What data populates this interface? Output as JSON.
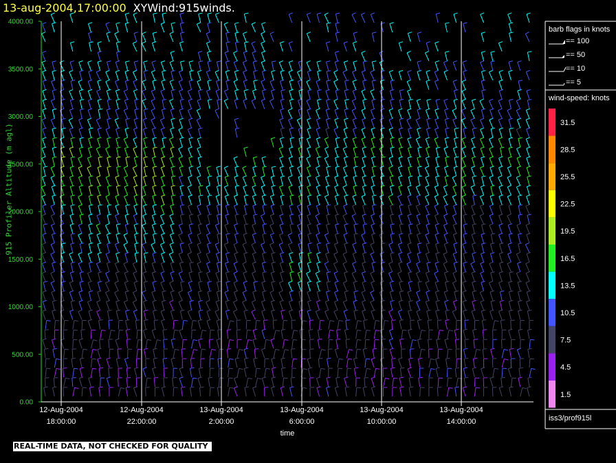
{
  "header": {
    "timestamp": "13-aug-2004,17:00:00",
    "product": "XYWind:915winds."
  },
  "notice": "REAL-TIME DATA, NOT CHECKED FOR QUALITY",
  "station": "iss3/prof915l",
  "chart_data": {
    "type": "wind-barb time-height",
    "title": "XYWind:915winds.",
    "xlabel": "time",
    "ylabel": "915 Profiler Altitude (m agl)",
    "ylim": [
      0,
      4000
    ],
    "yticks": [
      "0.00",
      "500.00",
      "1000.00",
      "1500.00",
      "2000.00",
      "2500.00",
      "3000.00",
      "3500.00",
      "4000.00"
    ],
    "xticks": [
      {
        "date": "12-Aug-2004",
        "time": "18:00:00"
      },
      {
        "date": "12-Aug-2004",
        "time": "22:00:00"
      },
      {
        "date": "13-Aug-2004",
        "time": "2:00:00"
      },
      {
        "date": "13-Aug-2004",
        "time": "6:00:00"
      },
      {
        "date": "13-Aug-2004",
        "time": "10:00:00"
      },
      {
        "date": "13-Aug-2004",
        "time": "14:00:00"
      }
    ],
    "barb_legend": {
      "title": "barb flags in knots",
      "entries": [
        "== 100",
        "== 50",
        "== 10",
        "== 5"
      ]
    },
    "speed_legend": {
      "title": "wind-speed: knots",
      "levels": [
        {
          "label": "31.5",
          "color": "#ff2244"
        },
        {
          "label": "28.5",
          "color": "#ff8800"
        },
        {
          "label": "25.5",
          "color": "#ffaa00"
        },
        {
          "label": "22.5",
          "color": "#ffff00"
        },
        {
          "label": "19.5",
          "color": "#aaee22"
        },
        {
          "label": "16.5",
          "color": "#22ee22"
        },
        {
          "label": "13.5",
          "color": "#00ffff"
        },
        {
          "label": "10.5",
          "color": "#4455ff"
        },
        {
          "label": "7.5",
          "color": "#444466"
        },
        {
          "label": "4.5",
          "color": "#9922ee"
        },
        {
          "label": "1.5",
          "color": "#ee88ee"
        }
      ]
    }
  }
}
